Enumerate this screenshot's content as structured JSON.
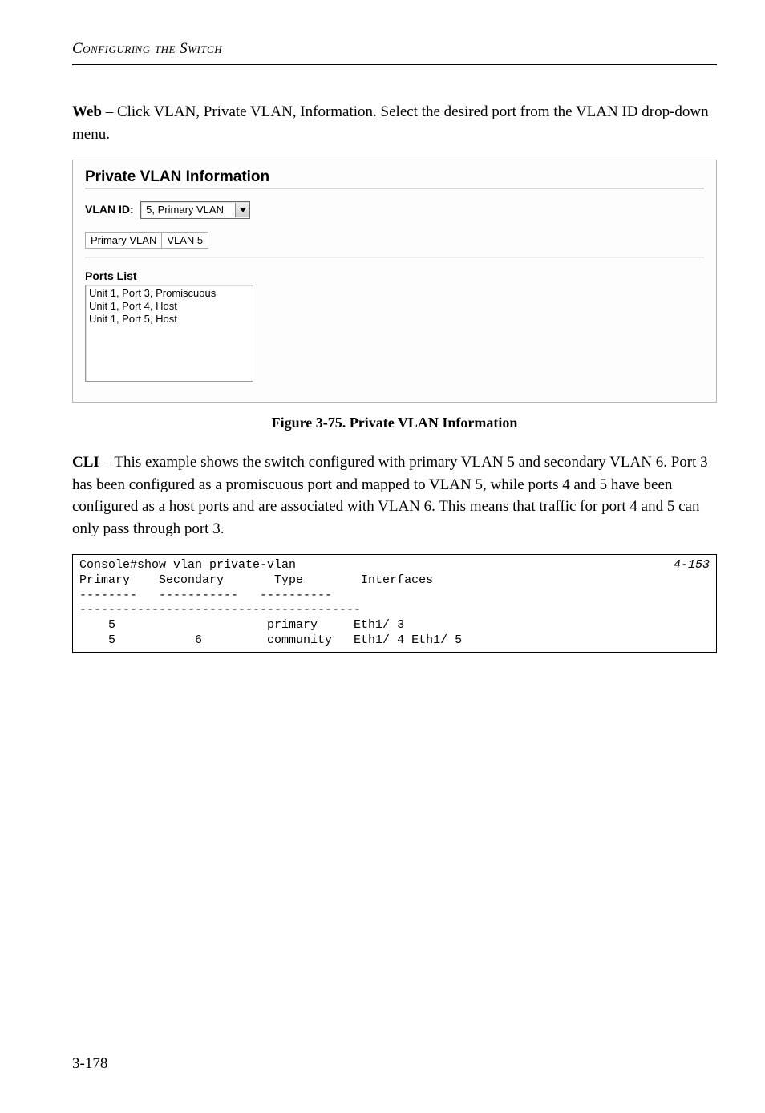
{
  "header": {
    "section": "Configuring the Switch"
  },
  "intro": {
    "leadBold": "Web",
    "rest": " – Click VLAN, Private VLAN, Information. Select the desired port from the VLAN ID drop-down menu."
  },
  "panel": {
    "title": "Private VLAN Information",
    "vlanIdLabel": "VLAN ID:",
    "vlanIdValue": "5, Primary VLAN",
    "miniTable": {
      "c1": "Primary VLAN",
      "c2": "VLAN 5"
    },
    "listHeading": "Ports List",
    "listItems": [
      "Unit 1, Port 3, Promiscuous",
      "Unit 1, Port 4, Host",
      "Unit 1, Port 5, Host"
    ]
  },
  "figureCaption": "Figure 3-75.  Private VLAN Information",
  "cliPara": {
    "leadBold": "CLI",
    "rest": " – This example shows the switch configured with primary VLAN 5 and secondary VLAN 6. Port 3 has been configured as a promiscuous port and mapped to VLAN 5, while ports 4 and 5 have been configured as a host ports and are associated with VLAN 6. This means that traffic for port 4 and 5 can only pass through port 3."
  },
  "cli": {
    "ref": "4-153",
    "line1": "Console#show vlan private-vlan",
    "line2": "Primary    Secondary       Type        Interfaces",
    "line3": "--------   -----------   ----------",
    "line4": "---------------------------------------",
    "line5": "    5                     primary     Eth1/ 3",
    "line6": "    5           6         community   Eth1/ 4 Eth1/ 5"
  },
  "pageNumber": "3-178"
}
